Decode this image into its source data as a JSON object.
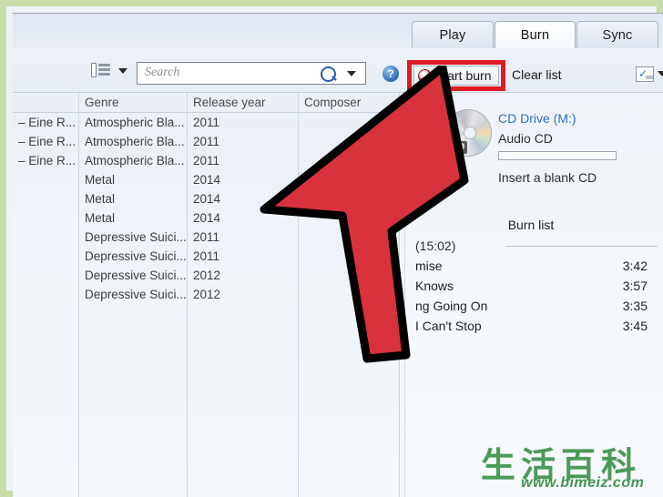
{
  "window": {
    "accent_blue": "#2a6ebb",
    "highlight_red": "#e01b24",
    "watermark_green": "#2f8a3e"
  },
  "tabs": [
    {
      "label": "Play",
      "active": false
    },
    {
      "label": "Burn",
      "active": true
    },
    {
      "label": "Sync",
      "active": false
    }
  ],
  "toolbar": {
    "view_icon": "list-view-icon",
    "view_caret": "chevron-down-icon",
    "search_placeholder": "Search",
    "search_value": "",
    "search_icon": "search-icon",
    "search_caret": "chevron-down-icon",
    "help_label": "?",
    "start_burn_label": "Start burn",
    "start_burn_icon": "burn-disc-icon",
    "clear_list_label": "Clear list",
    "layout_icon": "layout-options-icon",
    "layout_caret": "chevron-down-icon"
  },
  "library": {
    "columns": [
      "",
      "Genre",
      "Release year",
      "Composer"
    ],
    "rows": [
      {
        "title": "– Eine R...",
        "genre": "Atmospheric Bla...",
        "year": "2011",
        "composer": ""
      },
      {
        "title": "– Eine R...",
        "genre": "Atmospheric Bla...",
        "year": "2011",
        "composer": ""
      },
      {
        "title": "– Eine R...",
        "genre": "Atmospheric Bla...",
        "year": "2011",
        "composer": ""
      },
      {
        "title": "",
        "genre": "Metal",
        "year": "2014",
        "composer": ""
      },
      {
        "title": "",
        "genre": "Metal",
        "year": "2014",
        "composer": ""
      },
      {
        "title": "",
        "genre": "Metal",
        "year": "2014",
        "composer": ""
      },
      {
        "title": "",
        "genre": "Depressive Suici...",
        "year": "2011",
        "composer": ""
      },
      {
        "title": "",
        "genre": "Depressive Suici...",
        "year": "2011",
        "composer": ""
      },
      {
        "title": "",
        "genre": "Depressive Suici...",
        "year": "2012",
        "composer": ""
      },
      {
        "title": "",
        "genre": "Depressive Suici...",
        "year": "2012",
        "composer": ""
      }
    ]
  },
  "burn_panel": {
    "drive_name": "CD Drive (M:)",
    "drive_type": "Audio CD",
    "drive_status": "Insert a blank CD",
    "disc_icon": "cd-disc-icon",
    "disc_badge": "DVD",
    "burn_list_title": "Burn list",
    "disc_header": "(15:02)",
    "tracks": [
      {
        "name": "mise",
        "time": "3:42"
      },
      {
        "name": "Knows",
        "time": "3:57"
      },
      {
        "name": "ng Going On",
        "time": "3:35"
      },
      {
        "name": "I Can't Stop",
        "time": "3:45"
      }
    ]
  },
  "watermark": {
    "text_cn": "生活百科",
    "url": "www.bimeiz.com"
  }
}
